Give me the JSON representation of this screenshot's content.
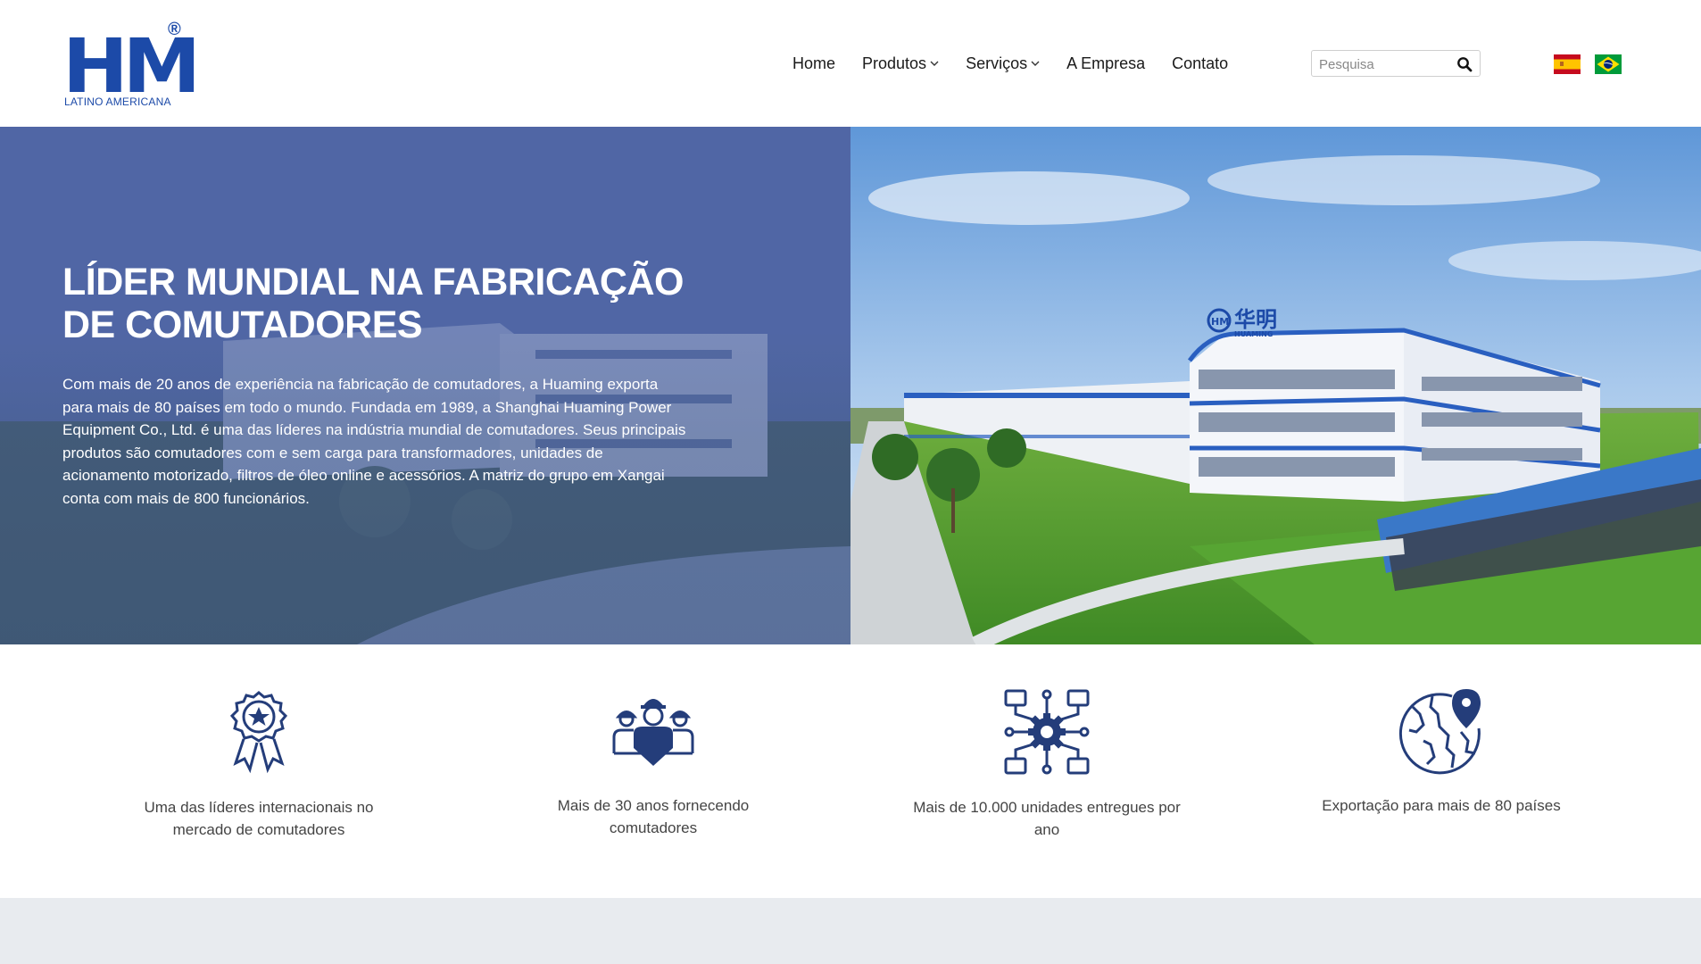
{
  "brand": {
    "logo_text": "HM",
    "registered_mark": "®",
    "logo_subtitle": "LATINO AMERICANA",
    "brand_color": "#1c4aa8"
  },
  "nav": {
    "items": [
      {
        "label": "Home",
        "has_dropdown": false
      },
      {
        "label": "Produtos",
        "has_dropdown": true
      },
      {
        "label": "Serviços",
        "has_dropdown": true
      },
      {
        "label": "A Empresa",
        "has_dropdown": false
      },
      {
        "label": "Contato",
        "has_dropdown": false
      }
    ]
  },
  "search": {
    "placeholder": "Pesquisa",
    "value": "",
    "icon": "search-icon"
  },
  "languages": [
    {
      "icon": "spain-flag-icon"
    },
    {
      "icon": "brazil-flag-icon"
    }
  ],
  "hero": {
    "title": "LÍDER MUNDIAL NA FABRICAÇÃO DE COMUTADORES",
    "text": "Com mais de 20 anos de experiência na fabricação de comutadores, a Huaming exporta para mais de 80 países em todo o mundo. Fundada em 1989, a Shanghai Huaming Power Equipment Co., Ltd. é uma das líderes na indústria mundial de comutadores. Seus principais produtos são comutadores com e sem carga para transformadores, unidades de acionamento motorizado, filtros de óleo online e acessórios. A matriz do grupo em Xangai conta com mais de 800 funcionários.",
    "overlay_color": "#465c9e",
    "building_sign": "华明",
    "building_sign_sub": "HUAMING"
  },
  "features": [
    {
      "icon": "award-medal-icon",
      "text": "Uma das líderes internacionais no mercado de comutadores"
    },
    {
      "icon": "workers-team-icon",
      "text": "Mais de 30 anos fornecendo comutadores"
    },
    {
      "icon": "network-gear-icon",
      "text": "Mais de 10.000 unidades entregues por ano"
    },
    {
      "icon": "globe-location-icon",
      "text": "Exportação para mais de 80 países"
    }
  ],
  "icon_color": "#243d7a"
}
